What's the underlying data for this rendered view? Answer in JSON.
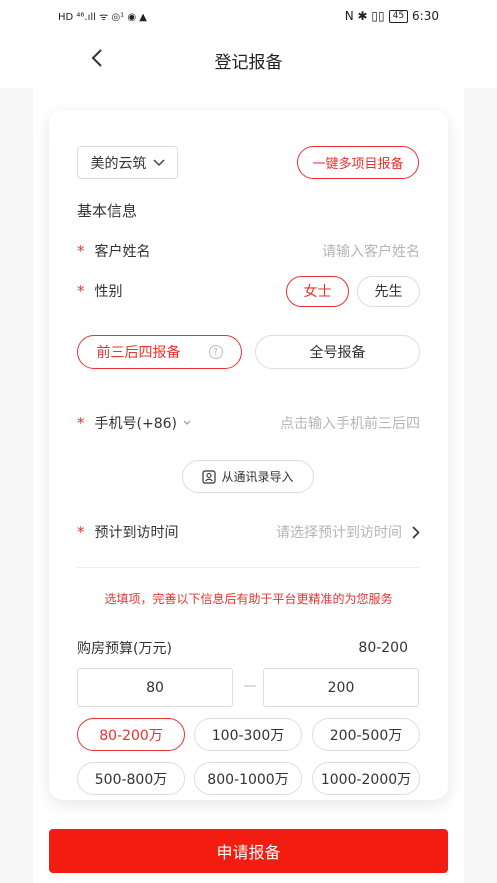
{
  "status_bar": {
    "left_icons": "HD ⁴⁶.ıll ᯤ ◎¹ ◉ ▲",
    "right_icons": "N ✱ ▯▯",
    "battery": "45",
    "time": "6:30"
  },
  "nav": {
    "title": "登记报备"
  },
  "project": {
    "selected": "美的云筑",
    "multi_button": "一键多项目报备"
  },
  "basic_info": {
    "title": "基本信息",
    "required_mark": "*",
    "name_label": "客户姓名",
    "name_placeholder": "请输入客户姓名",
    "gender_label": "性别",
    "gender_female": "女士",
    "gender_male": "先生"
  },
  "report_mode": {
    "partial": "前三后四报备",
    "help": "?",
    "full": "全号报备"
  },
  "phone": {
    "label": "手机号(+86)",
    "placeholder": "点击输入手机前三后四",
    "import_button": "从通讯录导入"
  },
  "visit": {
    "label": "预计到访时间",
    "placeholder": "请选择预计到访时间"
  },
  "optional_tip": "选填项，完善以下信息后有助于平台更精准的为您服务",
  "budget": {
    "label": "购房预算(万元)",
    "range_display": "80-200",
    "min": "80",
    "max": "200",
    "separator": "—",
    "options": [
      "80-200万",
      "100-300万",
      "200-500万",
      "500-800万",
      "800-1000万",
      "1000-2000万"
    ],
    "selected_index": 0
  },
  "submit": {
    "label": "申请报备"
  },
  "colors": {
    "accent": "#e8322f",
    "submit": "#f21d10"
  },
  "icons": [
    "back-icon",
    "chevron-down-icon",
    "help-icon",
    "contacts-icon",
    "chevron-right-icon"
  ]
}
